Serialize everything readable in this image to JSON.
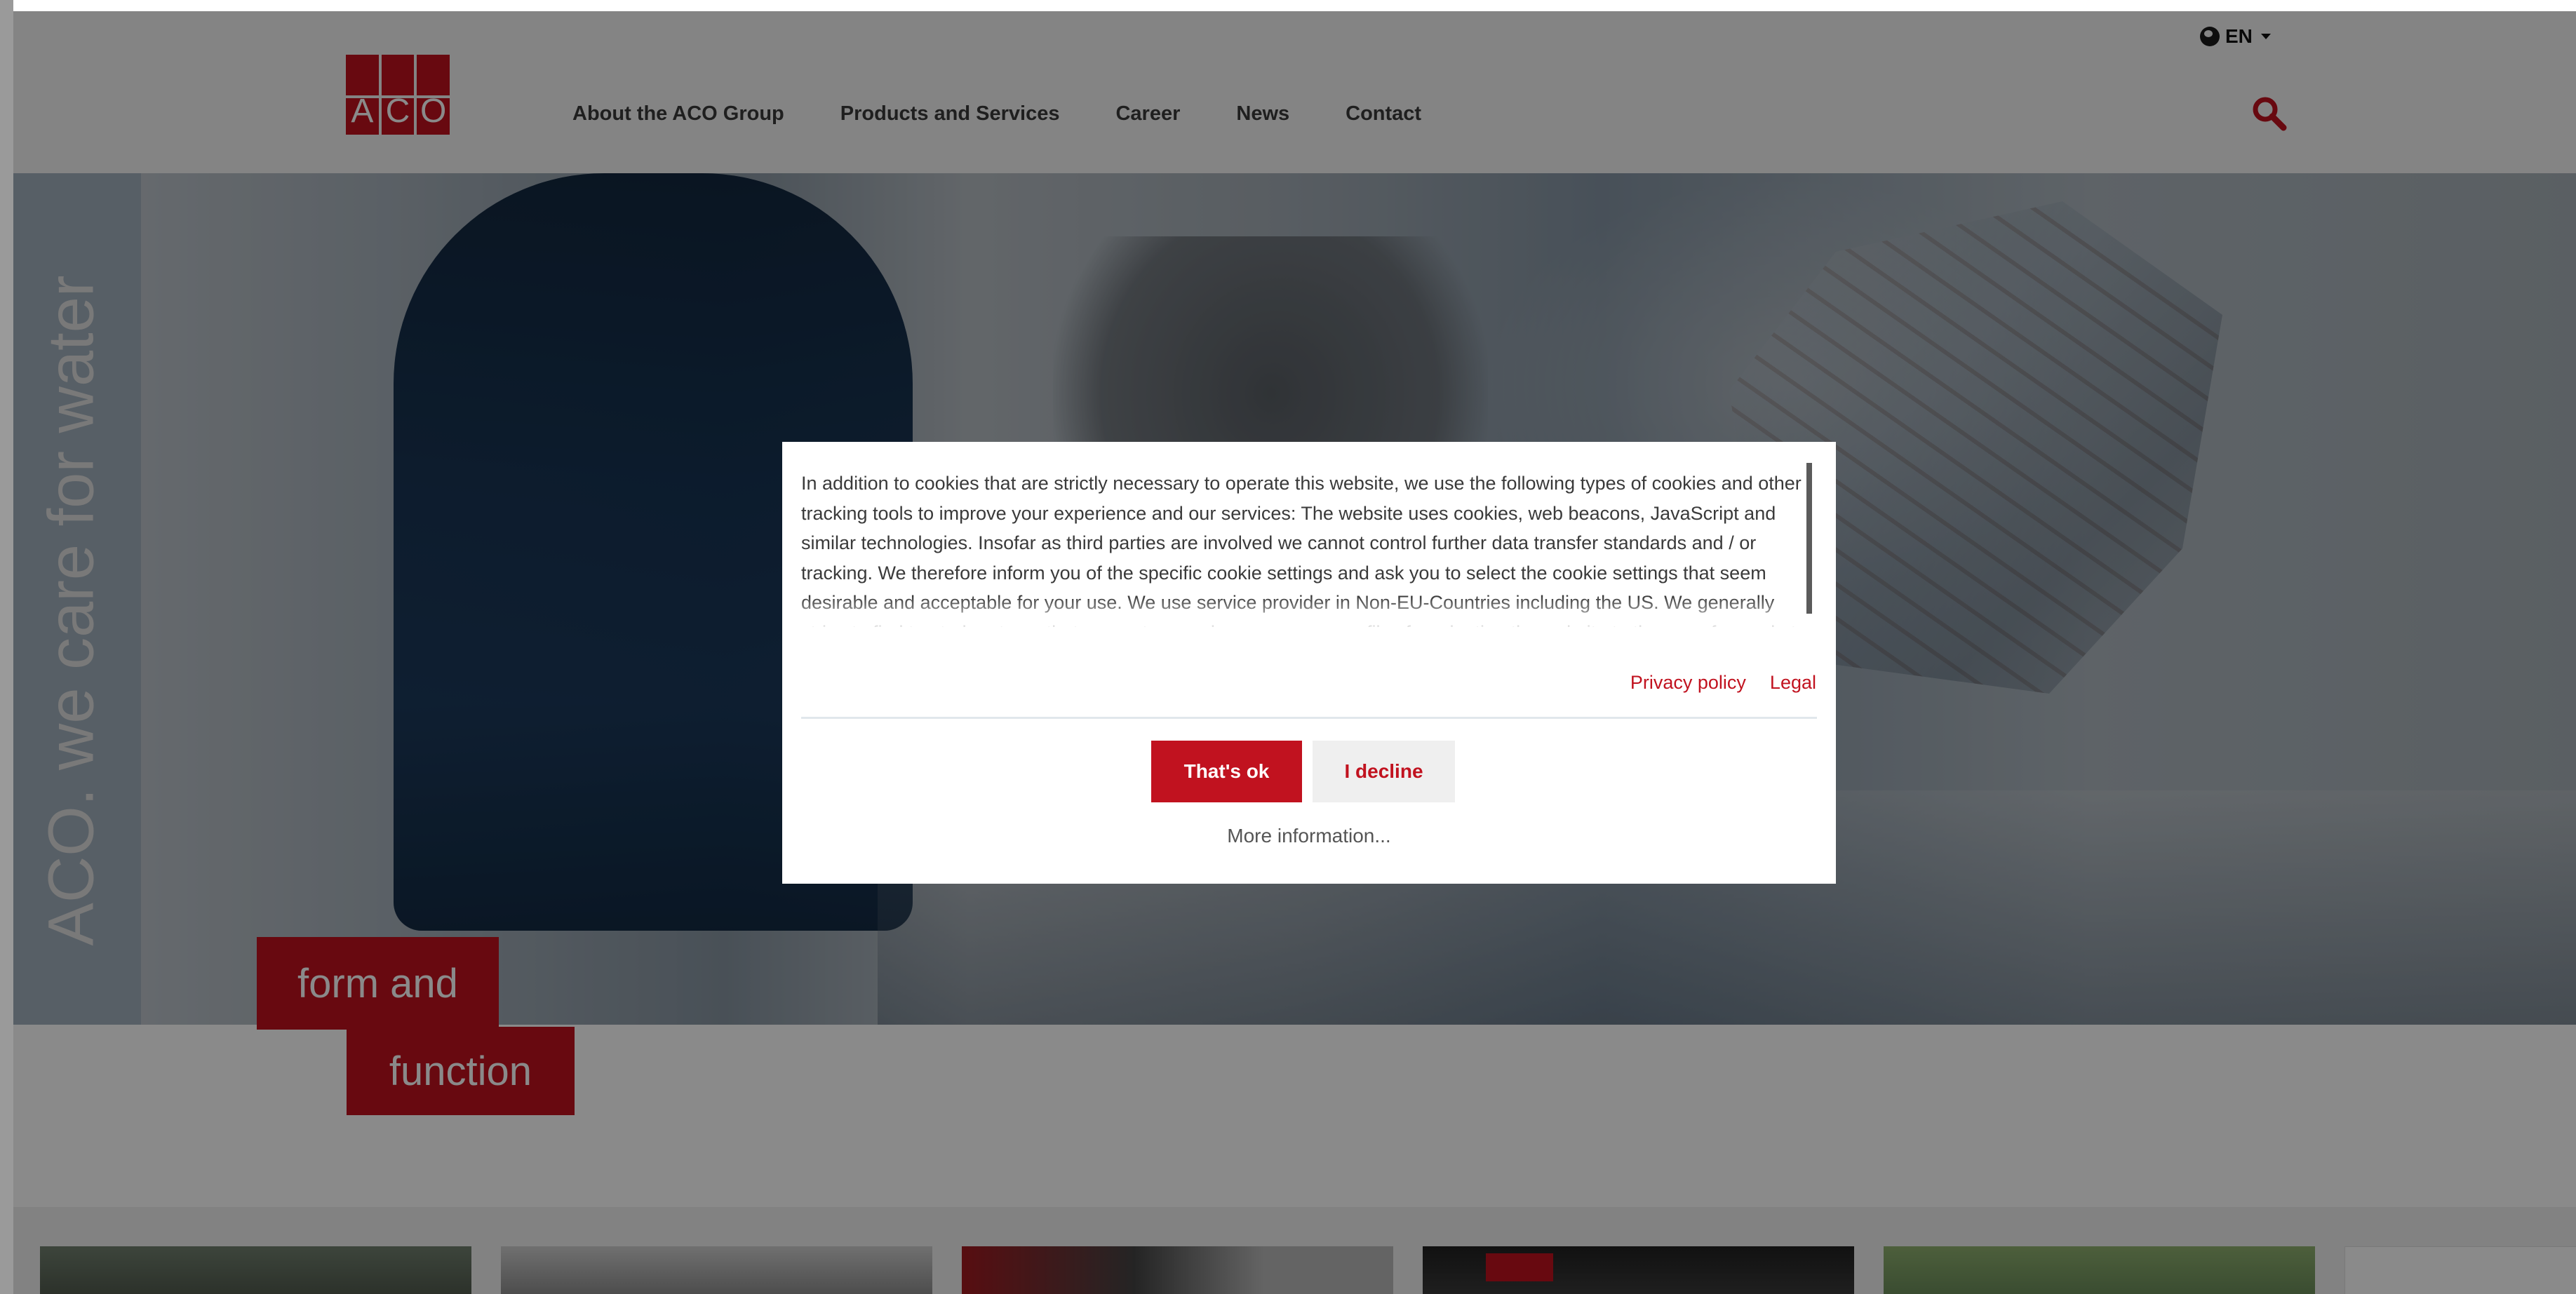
{
  "header": {
    "logo_letters": [
      "A",
      "C",
      "O"
    ],
    "nav": {
      "about": "About the ACO Group",
      "products": "Products and Services",
      "career": "Career",
      "news": "News",
      "contact": "Contact"
    },
    "language": "EN"
  },
  "hero": {
    "slogan": "ACO. we care for water",
    "badge_line1": "form and",
    "badge_line2": "function"
  },
  "cookie_dialog": {
    "text": "In addition to cookies that are strictly necessary to operate this website, we use the following types of cookies and other tracking tools to improve your experience and our services: The website uses cookies, web beacons, JavaScript and similar technologies. Insofar as third parties are involved we cannot control further data transfer standards and / or tracking. We therefore inform you of the specific cookie settings and ask you to select the cookie settings that seem desirable and acceptable for your use. We use service provider in Non-EU-Countries including the US. We generally strive to find trusted partners that generate pseudonymous user profiles for adapting the website to the user, for market research and for advertising. Generated data can also be shared with third parties while the user",
    "privacy_link": "Privacy policy",
    "legal_link": "Legal",
    "accept_button": "That's ok",
    "decline_button": "I decline",
    "more_info": "More information..."
  },
  "colors": {
    "brand_red": "#c1121f",
    "overlay": "rgba(0,0,0,0.46)"
  },
  "icons": {
    "search": "search-icon",
    "language": "globe-icon"
  }
}
